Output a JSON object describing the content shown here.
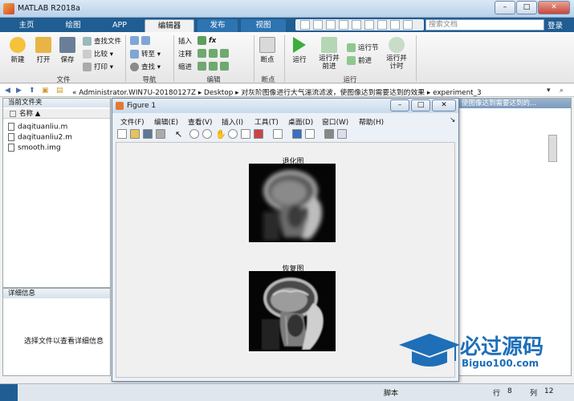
{
  "window": {
    "title": "MATLAB R2018a",
    "min": "–",
    "max": "□",
    "close": "✕"
  },
  "tabs": [
    {
      "label": "主页"
    },
    {
      "label": "绘图"
    },
    {
      "label": "APP"
    },
    {
      "label": "编辑器"
    },
    {
      "label": "发布"
    },
    {
      "label": "视图"
    }
  ],
  "search_placeholder": "搜索文档",
  "login_label": "登录",
  "ribbon": {
    "file": {
      "new": "新建",
      "open": "打开",
      "save": "保存",
      "find_files": "查找文件",
      "compare": "比较",
      "print": "打印",
      "group": "文件"
    },
    "nav": {
      "goto": "转至",
      "find": "查找",
      "group": "导航"
    },
    "edit": {
      "insert": "插入",
      "comment": "注释",
      "indent": "缩进",
      "fx": "fx",
      "group": "编辑"
    },
    "breakpoints": {
      "label": "断点",
      "group": "断点"
    },
    "run": {
      "run": "运行",
      "run_advance": "运行并前进",
      "run_section": "运行节",
      "advance": "前进",
      "run_time": "运行并计时",
      "group": "运行"
    }
  },
  "address": {
    "segments": [
      "«",
      "Administrator.WIN7U-20180127Z",
      "▸",
      "Desktop",
      "▸",
      "对灰阶图像进行大气湍流滤波，使图像达到需要达到的效果",
      "▸",
      "experiment_3"
    ]
  },
  "current_folder": {
    "title": "当前文件夹",
    "column": "名称 ▲",
    "files": [
      {
        "name": "daqituanliu.m"
      },
      {
        "name": "daqituanliu2.m"
      },
      {
        "name": "smooth.img"
      }
    ]
  },
  "details": {
    "title": "详细信息",
    "message": "选择文件以查看详细信息"
  },
  "right_panel": {
    "title": "使图像达到需要达到的..."
  },
  "figure": {
    "title": "Figure 1",
    "menu": [
      "文件(F)",
      "编辑(E)",
      "查看(V)",
      "插入(I)",
      "工具(T)",
      "桌面(D)",
      "窗口(W)",
      "帮助(H)"
    ],
    "images": [
      {
        "title": "退化图"
      },
      {
        "title": "恢复图"
      }
    ]
  },
  "status": {
    "script": "脚本",
    "line_label": "行",
    "line": "8",
    "col_label": "列",
    "col": "12"
  },
  "watermark": {
    "main": "必过源码",
    "sub": "Biguo100.com"
  },
  "colors": {
    "tabbar": "#1f5d92",
    "accent": "#2e74b0",
    "watermark": "#1e6fb8"
  }
}
